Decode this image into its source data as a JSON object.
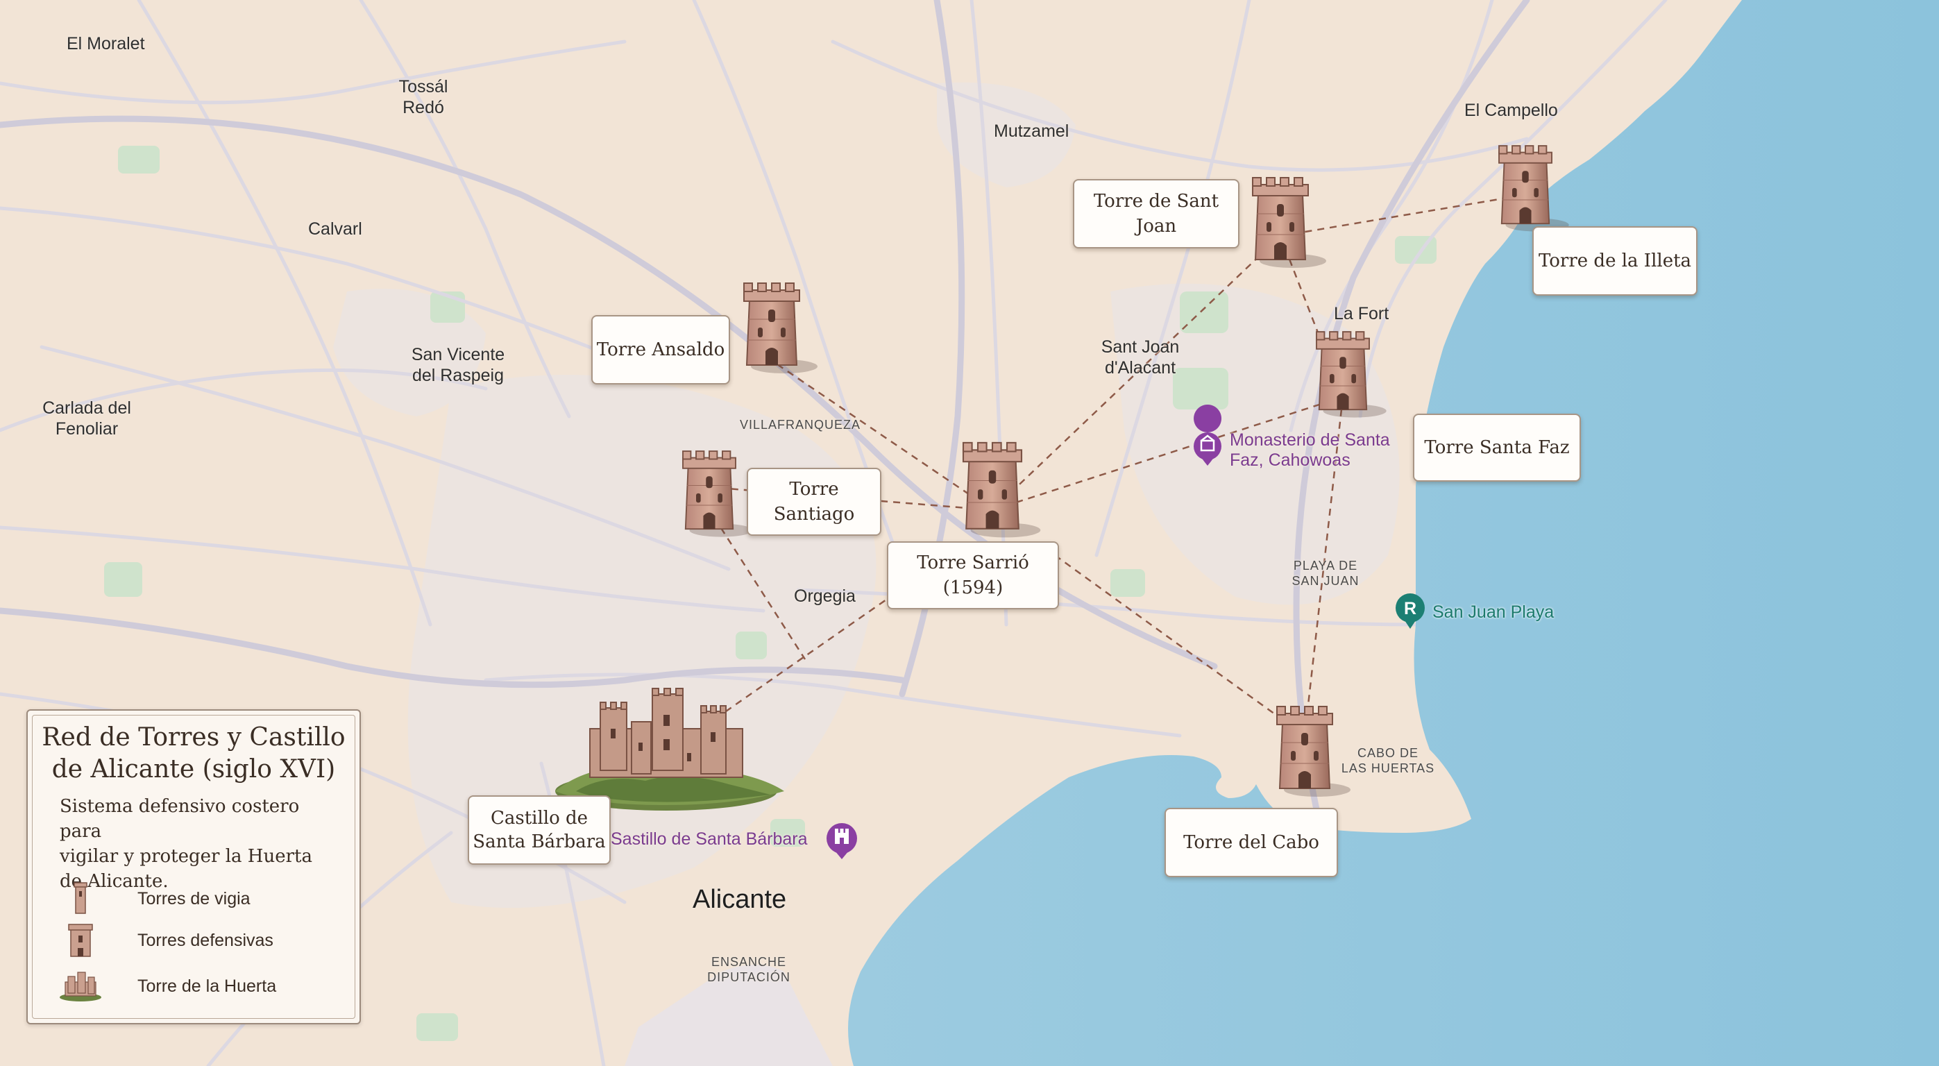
{
  "map": {
    "colors": {
      "land": "#f2e4d6",
      "water": "#94c7de",
      "roads": "#d7d7e0",
      "parks": "#cfe3cc",
      "dashed_lines": "#8e5a48"
    }
  },
  "places": {
    "el_moralet": "El Moralet",
    "tossal_1": "Tossál",
    "tossal_2": "Redó",
    "calvari": "Calvarl",
    "san_vicente_1": "San Vicente",
    "san_vicente_2": "del Raspeig",
    "carlada_1": "Carlada del",
    "carlada_2": "Fenoliar",
    "mutxamel": "Mutzamel",
    "el_campello": "El Campello",
    "la_fort": "La Fort",
    "sant_joan_1": "Sant Joan",
    "sant_joan_2": "d'Alacant",
    "villafranqueza": "VILLAFRANQUEZA",
    "orgegia": "Orgegia",
    "playa_sj_1": "PLAYA DE",
    "playa_sj_2": "SAN JUAN",
    "cabo_1": "CABO DE",
    "cabo_2": "LAS HUERTAS",
    "alicante": "Alicante",
    "ensanche_1": "ENSANCHE",
    "ensanche_2": "DIPUTACIÓN"
  },
  "pois": {
    "monasterio_1": "Monasterio de Santa",
    "monasterio_2": "Faz, Cahowoas",
    "san_juan_playa": "San Juan Playa",
    "castillo_poi": "Sastillo de Santa Bárbara"
  },
  "labels": {
    "torre_sant_joan": "Torre de Sant Joan",
    "torre_illeta": "Torre de la Illeta",
    "torre_ansaldo": "Torre Ansaldo",
    "torre_santiago": "Torre Santiago",
    "torre_sarrio": "Torre Sarrió (1594)",
    "torre_santa_faz": "Torre Santa Faz",
    "torre_cabo": "Torre del Cabo",
    "castillo_1": "Castillo de",
    "castillo_2": "Santa Bárbara"
  },
  "legend": {
    "title_1": "Red de Torres y Castillo",
    "title_2": "de Alicante (siglo XVI)",
    "desc_1": "Sistema defensivo costero para",
    "desc_2": "vigilar y proteger la Huerta",
    "desc_3": "de Alicante.",
    "items": [
      {
        "label": "Torres de vigia",
        "icon": "lookout-tower-icon"
      },
      {
        "label": "Torres defensivas",
        "icon": "defensive-tower-icon"
      },
      {
        "label": "Torre de la Huerta",
        "icon": "castle-icon"
      }
    ]
  }
}
